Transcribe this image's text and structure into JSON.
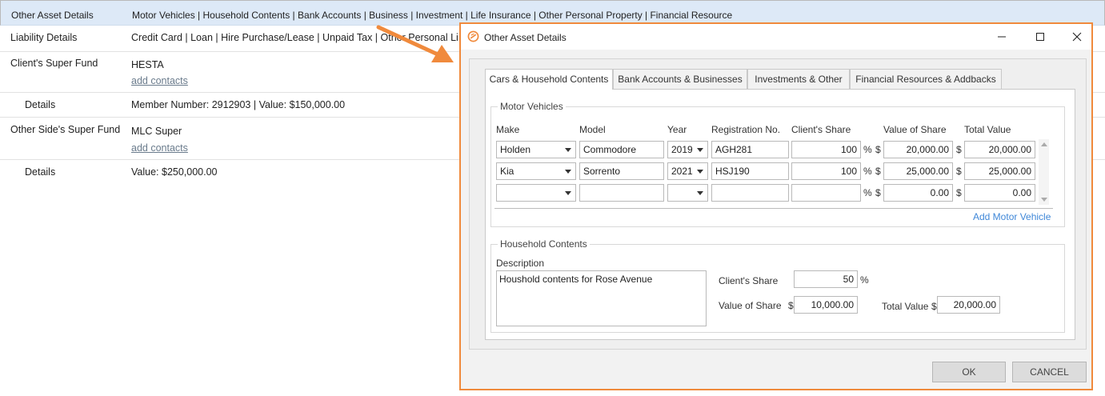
{
  "background": {
    "rows": [
      {
        "label": "Other Asset Details",
        "value": "Motor Vehicles | Household Contents | Bank Accounts | Business | Investment | Life Insurance | Other Personal Property | Financial Resource"
      },
      {
        "label": "Liability Details",
        "value": "Credit Card | Loan | Hire Purchase/Lease | Unpaid Tax | Other Personal Li"
      },
      {
        "label": "Client's Super Fund",
        "value": "HESTA",
        "link": "add contacts"
      },
      {
        "label": "Details",
        "value": "Member Number: 2912903 | Value: $150,000.00"
      },
      {
        "label": "Other Side's Super Fund",
        "value": "MLC Super",
        "link": "add contacts"
      },
      {
        "label": "Details",
        "value": "Value: $250,000.00"
      }
    ]
  },
  "dialog": {
    "title": "Other Asset Details",
    "accent_color": "#f08a3c",
    "tabs": [
      "Cars & Household Contents",
      "Bank Accounts & Businesses",
      "Investments & Other",
      "Financial Resources & Addbacks"
    ],
    "active_tab": "Cars & Household Contents",
    "motor_vehicles": {
      "legend": "Motor Vehicles",
      "columns": [
        "Make",
        "Model",
        "Year",
        "Registration No.",
        "Client's Share",
        "Value of Share",
        "Total Value"
      ],
      "percent_symbol": "%",
      "currency_symbol": "$",
      "rows": [
        {
          "make": "Holden",
          "model": "Commodore",
          "year": "2019",
          "registration": "AGH281",
          "client_share": "100",
          "value_of_share": "20,000.00",
          "total_value": "20,000.00"
        },
        {
          "make": "Kia",
          "model": "Sorrento",
          "year": "2021",
          "registration": "HSJ190",
          "client_share": "100",
          "value_of_share": "25,000.00",
          "total_value": "25,000.00"
        },
        {
          "make": "",
          "model": "",
          "year": "",
          "registration": "",
          "client_share": "",
          "value_of_share": "0.00",
          "total_value": "0.00"
        }
      ],
      "add_link": "Add Motor Vehicle"
    },
    "household": {
      "legend": "Household Contents",
      "description_label": "Description",
      "description": "Houshold contents for Rose Avenue",
      "client_share_label": "Client's Share",
      "client_share": "50",
      "value_of_share_label": "Value of Share",
      "value_of_share": "10,000.00",
      "total_value_label": "Total Value",
      "total_value": "20,000.00"
    },
    "ok_label": "OK",
    "cancel_label": "CANCEL"
  }
}
